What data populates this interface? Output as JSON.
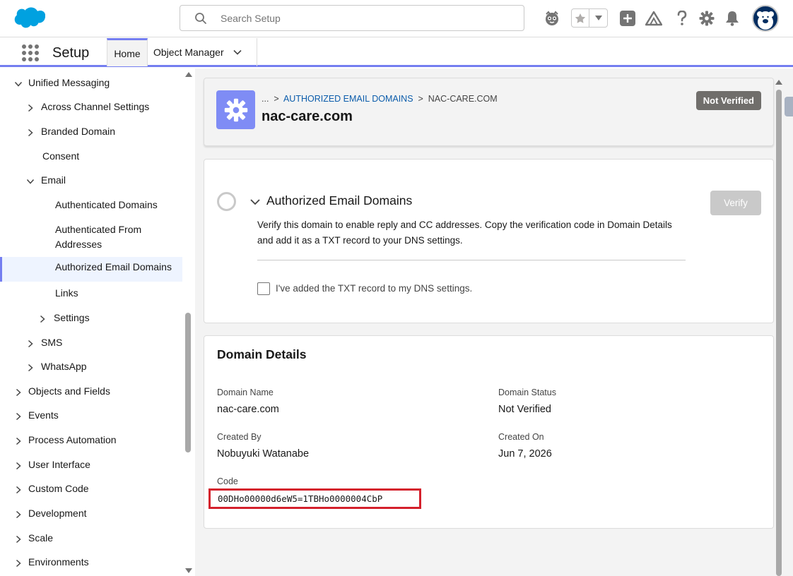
{
  "header": {
    "search_placeholder": "Search Setup",
    "icons": [
      "salesforce-cloud-logo",
      "einstein-icon",
      "favorite-star-icon",
      "add-icon",
      "trailhead-icon",
      "help-icon",
      "setup-gear-icon",
      "notifications-bell-icon",
      "avatar"
    ]
  },
  "nav": {
    "app_name": "Setup",
    "tabs": [
      {
        "label": "Home",
        "active": true
      },
      {
        "label": "Object Manager",
        "active": false
      }
    ]
  },
  "sidebar": {
    "items": [
      {
        "label": "Unified Messaging",
        "level": 0,
        "expanded": true
      },
      {
        "label": "Across Channel Settings",
        "level": 1,
        "expanded": false
      },
      {
        "label": "Branded Domain",
        "level": 1,
        "expanded": false
      },
      {
        "label": "Consent",
        "level": 1
      },
      {
        "label": "Email",
        "level": 1,
        "expanded": true
      },
      {
        "label": "Authenticated Domains",
        "level": 2
      },
      {
        "label": "Authenticated From Addresses",
        "level": 2
      },
      {
        "label": "Authorized Email Domains",
        "level": 2,
        "selected": true
      },
      {
        "label": "Links",
        "level": 2
      },
      {
        "label": "Settings",
        "level": 2,
        "expanded": false
      },
      {
        "label": "SMS",
        "level": 1,
        "expanded": false
      },
      {
        "label": "WhatsApp",
        "level": 1,
        "expanded": false
      },
      {
        "label": "Objects and Fields",
        "level": 0,
        "expanded": false
      },
      {
        "label": "Events",
        "level": 0,
        "expanded": false
      },
      {
        "label": "Process Automation",
        "level": 0,
        "expanded": false
      },
      {
        "label": "User Interface",
        "level": 0,
        "expanded": false
      },
      {
        "label": "Custom Code",
        "level": 0,
        "expanded": false
      },
      {
        "label": "Development",
        "level": 0,
        "expanded": false
      },
      {
        "label": "Scale",
        "level": 0,
        "expanded": false
      },
      {
        "label": "Environments",
        "level": 0,
        "expanded": false
      }
    ]
  },
  "record": {
    "breadcrumb_ellipsis": "...",
    "breadcrumb_parent": "AUTHORIZED EMAIL DOMAINS",
    "breadcrumb_current": "NAC-CARE.COM",
    "title": "nac-care.com",
    "status_badge": "Not Verified"
  },
  "verify_section": {
    "title": "Authorized Email Domains",
    "button": "Verify",
    "description": "Verify this domain to enable reply and CC addresses. Copy the verification code in Domain Details and add it as a TXT record to your DNS settings.",
    "checkbox_label": "I've added the TXT record to my DNS settings.",
    "checked": false
  },
  "domain_details": {
    "title": "Domain Details",
    "domain_name_label": "Domain Name",
    "domain_name": "nac-care.com",
    "domain_status_label": "Domain Status",
    "domain_status": "Not Verified",
    "created_by_label": "Created By",
    "created_by": "Nobuyuki Watanabe",
    "created_on_label": "Created On",
    "created_on": "Jun 7, 2026",
    "code_label": "Code",
    "code": "00DHo00000d6eW5=1TBHo0000004CbP"
  },
  "colors": {
    "brand_blue": "#00a1e0",
    "accent": "#747ef0",
    "object_icon": "#7f8cf5",
    "badge": "#706e6b",
    "highlight_border": "#d4202c"
  }
}
